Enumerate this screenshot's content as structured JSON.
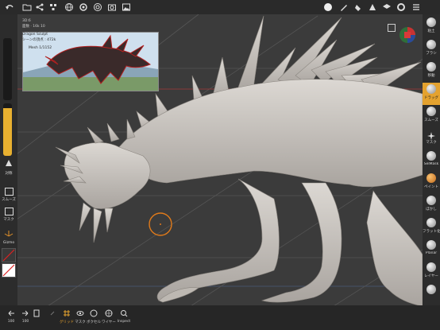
{
  "info": {
    "line1": "3D:6",
    "line2": "面数 · 16k 10",
    "line3": "Dragon Sculpt",
    "line4": "シーンの頂点 : 472k",
    "line5": "Mesh 1/1152"
  },
  "left_panel": {
    "radius_label": "対称",
    "buttons": [
      {
        "label": "スムーズ",
        "icon": "smooth-icon"
      },
      {
        "label": "マスク",
        "icon": "mask-icon"
      },
      {
        "label": "Gizmo",
        "icon": "gizmo-icon"
      }
    ]
  },
  "right_tools": [
    {
      "label": "粘土",
      "icon": "clay-icon",
      "active": false
    },
    {
      "label": "ブラシ",
      "icon": "brush-icon",
      "active": false
    },
    {
      "label": "移動",
      "icon": "move-icon",
      "active": false
    },
    {
      "label": "ドラッグ",
      "icon": "drag-icon",
      "active": true
    },
    {
      "label": "スムーズ",
      "icon": "smooth-icon",
      "active": false
    },
    {
      "label": "マスク",
      "icon": "mask-icon",
      "active": false
    },
    {
      "label": "SelMask",
      "icon": "selmask-icon",
      "active": false
    },
    {
      "label": "ペイント",
      "icon": "paint-icon",
      "active": false
    },
    {
      "label": "ぼかし",
      "icon": "blur-icon",
      "active": false
    },
    {
      "label": "フラット化",
      "icon": "flatten-icon",
      "active": false
    },
    {
      "label": "Planar",
      "icon": "planar-icon",
      "active": false
    },
    {
      "label": "レイヤー",
      "icon": "layer-icon",
      "active": false
    },
    {
      "label": "",
      "icon": "extra-tool-icon",
      "active": false
    }
  ],
  "bottom_tools": [
    {
      "label": "100",
      "icon": "undo-icon"
    },
    {
      "label": "100",
      "icon": "redo-icon"
    },
    {
      "label": "",
      "icon": "file-icon"
    },
    {
      "label": "",
      "icon": "link-icon"
    },
    {
      "label": "グリッド",
      "icon": "grid-icon"
    },
    {
      "label": "マスク",
      "icon": "eye-icon"
    },
    {
      "label": "ボクセル",
      "icon": "voxel-icon"
    },
    {
      "label": "ワイヤー",
      "icon": "wire-icon"
    },
    {
      "label": "Inspect",
      "icon": "inspect-icon"
    }
  ],
  "colors": {
    "accent": "#e4a22f",
    "background": "#3c3c3c",
    "toolbar": "#2a2a2a",
    "sculpt": "#c9c6c2"
  }
}
